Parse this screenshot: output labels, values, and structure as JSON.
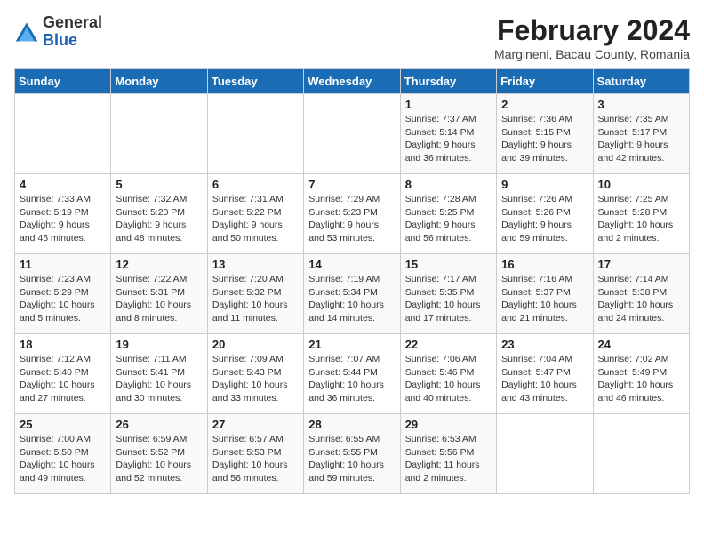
{
  "header": {
    "logo_general": "General",
    "logo_blue": "Blue",
    "month_year": "February 2024",
    "location": "Margineni, Bacau County, Romania"
  },
  "weekdays": [
    "Sunday",
    "Monday",
    "Tuesday",
    "Wednesday",
    "Thursday",
    "Friday",
    "Saturday"
  ],
  "weeks": [
    [
      {
        "day": "",
        "info": ""
      },
      {
        "day": "",
        "info": ""
      },
      {
        "day": "",
        "info": ""
      },
      {
        "day": "",
        "info": ""
      },
      {
        "day": "1",
        "info": "Sunrise: 7:37 AM\nSunset: 5:14 PM\nDaylight: 9 hours\nand 36 minutes."
      },
      {
        "day": "2",
        "info": "Sunrise: 7:36 AM\nSunset: 5:15 PM\nDaylight: 9 hours\nand 39 minutes."
      },
      {
        "day": "3",
        "info": "Sunrise: 7:35 AM\nSunset: 5:17 PM\nDaylight: 9 hours\nand 42 minutes."
      }
    ],
    [
      {
        "day": "4",
        "info": "Sunrise: 7:33 AM\nSunset: 5:19 PM\nDaylight: 9 hours\nand 45 minutes."
      },
      {
        "day": "5",
        "info": "Sunrise: 7:32 AM\nSunset: 5:20 PM\nDaylight: 9 hours\nand 48 minutes."
      },
      {
        "day": "6",
        "info": "Sunrise: 7:31 AM\nSunset: 5:22 PM\nDaylight: 9 hours\nand 50 minutes."
      },
      {
        "day": "7",
        "info": "Sunrise: 7:29 AM\nSunset: 5:23 PM\nDaylight: 9 hours\nand 53 minutes."
      },
      {
        "day": "8",
        "info": "Sunrise: 7:28 AM\nSunset: 5:25 PM\nDaylight: 9 hours\nand 56 minutes."
      },
      {
        "day": "9",
        "info": "Sunrise: 7:26 AM\nSunset: 5:26 PM\nDaylight: 9 hours\nand 59 minutes."
      },
      {
        "day": "10",
        "info": "Sunrise: 7:25 AM\nSunset: 5:28 PM\nDaylight: 10 hours\nand 2 minutes."
      }
    ],
    [
      {
        "day": "11",
        "info": "Sunrise: 7:23 AM\nSunset: 5:29 PM\nDaylight: 10 hours\nand 5 minutes."
      },
      {
        "day": "12",
        "info": "Sunrise: 7:22 AM\nSunset: 5:31 PM\nDaylight: 10 hours\nand 8 minutes."
      },
      {
        "day": "13",
        "info": "Sunrise: 7:20 AM\nSunset: 5:32 PM\nDaylight: 10 hours\nand 11 minutes."
      },
      {
        "day": "14",
        "info": "Sunrise: 7:19 AM\nSunset: 5:34 PM\nDaylight: 10 hours\nand 14 minutes."
      },
      {
        "day": "15",
        "info": "Sunrise: 7:17 AM\nSunset: 5:35 PM\nDaylight: 10 hours\nand 17 minutes."
      },
      {
        "day": "16",
        "info": "Sunrise: 7:16 AM\nSunset: 5:37 PM\nDaylight: 10 hours\nand 21 minutes."
      },
      {
        "day": "17",
        "info": "Sunrise: 7:14 AM\nSunset: 5:38 PM\nDaylight: 10 hours\nand 24 minutes."
      }
    ],
    [
      {
        "day": "18",
        "info": "Sunrise: 7:12 AM\nSunset: 5:40 PM\nDaylight: 10 hours\nand 27 minutes."
      },
      {
        "day": "19",
        "info": "Sunrise: 7:11 AM\nSunset: 5:41 PM\nDaylight: 10 hours\nand 30 minutes."
      },
      {
        "day": "20",
        "info": "Sunrise: 7:09 AM\nSunset: 5:43 PM\nDaylight: 10 hours\nand 33 minutes."
      },
      {
        "day": "21",
        "info": "Sunrise: 7:07 AM\nSunset: 5:44 PM\nDaylight: 10 hours\nand 36 minutes."
      },
      {
        "day": "22",
        "info": "Sunrise: 7:06 AM\nSunset: 5:46 PM\nDaylight: 10 hours\nand 40 minutes."
      },
      {
        "day": "23",
        "info": "Sunrise: 7:04 AM\nSunset: 5:47 PM\nDaylight: 10 hours\nand 43 minutes."
      },
      {
        "day": "24",
        "info": "Sunrise: 7:02 AM\nSunset: 5:49 PM\nDaylight: 10 hours\nand 46 minutes."
      }
    ],
    [
      {
        "day": "25",
        "info": "Sunrise: 7:00 AM\nSunset: 5:50 PM\nDaylight: 10 hours\nand 49 minutes."
      },
      {
        "day": "26",
        "info": "Sunrise: 6:59 AM\nSunset: 5:52 PM\nDaylight: 10 hours\nand 52 minutes."
      },
      {
        "day": "27",
        "info": "Sunrise: 6:57 AM\nSunset: 5:53 PM\nDaylight: 10 hours\nand 56 minutes."
      },
      {
        "day": "28",
        "info": "Sunrise: 6:55 AM\nSunset: 5:55 PM\nDaylight: 10 hours\nand 59 minutes."
      },
      {
        "day": "29",
        "info": "Sunrise: 6:53 AM\nSunset: 5:56 PM\nDaylight: 11 hours\nand 2 minutes."
      },
      {
        "day": "",
        "info": ""
      },
      {
        "day": "",
        "info": ""
      }
    ]
  ]
}
